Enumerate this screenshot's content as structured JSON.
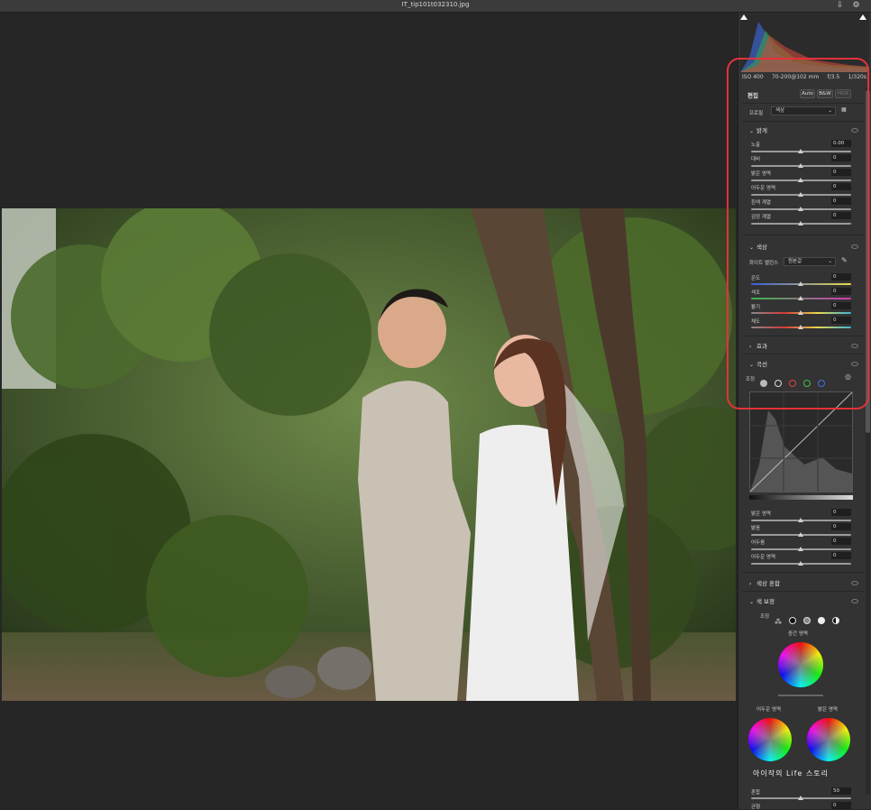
{
  "window": {
    "title": "IT_tip101t032310.jpg"
  },
  "exif": {
    "iso": "ISO 400",
    "lens": "70-200@102 mm",
    "aperture": "f/3.5",
    "shutter": "1/320s"
  },
  "edit": {
    "title": "편집",
    "auto": "Auto",
    "bw": "B&W",
    "hdr": "HDR"
  },
  "profile": {
    "label": "프로필",
    "value": "색상"
  },
  "light": {
    "title": "밝게",
    "sliders": [
      {
        "label": "노출",
        "value": "0.00"
      },
      {
        "label": "대비",
        "value": "0"
      },
      {
        "label": "밝은 영역",
        "value": "0"
      },
      {
        "label": "어두운 영역",
        "value": "0"
      },
      {
        "label": "흰색 계열",
        "value": "0"
      },
      {
        "label": "검정 계열",
        "value": "0"
      }
    ]
  },
  "color": {
    "title": "색상",
    "wb_label": "화이트 밸런스",
    "wb_value": "원본값",
    "sliders": [
      {
        "label": "온도",
        "value": "0"
      },
      {
        "label": "색조",
        "value": "0"
      },
      {
        "label": "활기",
        "value": "0"
      },
      {
        "label": "채도",
        "value": "0"
      }
    ]
  },
  "effects": {
    "title": "효과"
  },
  "curve": {
    "title": "곡선",
    "adjust_label": "조정",
    "sliders": [
      {
        "label": "밝은 영역",
        "value": "0"
      },
      {
        "label": "밝음",
        "value": "0"
      },
      {
        "label": "어두움",
        "value": "0"
      },
      {
        "label": "어두운 영역",
        "value": "0"
      }
    ]
  },
  "color_mixer": {
    "title": "색상 혼합"
  },
  "color_grading": {
    "title": "색 보정",
    "adjust_label": "조정",
    "midtones": "중간 영역",
    "shadows": "어두운 영역",
    "highlights": "밝은 영역",
    "blend_label": "혼합",
    "blend_value": "50",
    "balance_label": "균형",
    "balance_value": "0"
  },
  "watermark": {
    "text": "아이작의 Life 스토리"
  },
  "colors": {
    "accent_red": "#e5313a",
    "panel": "#333333",
    "bg": "#262626"
  }
}
